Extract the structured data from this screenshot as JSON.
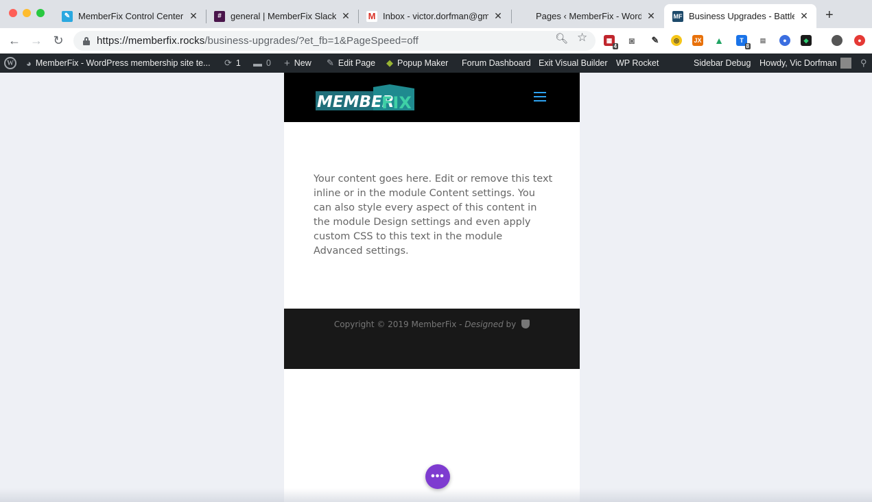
{
  "browser": {
    "tabs": [
      {
        "title": "MemberFix Control Center",
        "favicon_color": "#2aa8e0",
        "icon": "memberfix-tab-icon"
      },
      {
        "title": "general | MemberFix Slack",
        "favicon_color": "#4a154b",
        "icon": "slack-icon"
      },
      {
        "title": "Inbox - victor.dorfman@gm",
        "favicon_color": "#ffffff",
        "icon": "gmail-icon"
      },
      {
        "title": "Pages ‹ MemberFix - Word",
        "favicon_color": "#dee1e6",
        "icon": "wordpress-tab-icon"
      },
      {
        "title": "Business Upgrades - Battle",
        "favicon_color": "#1d4a6b",
        "icon": "memberfix-mf-icon"
      }
    ],
    "new_tab_label": "+",
    "url_host": "https://memberfix.rocks",
    "url_path": "/business-upgrades/?et_fb=1&PageSpeed=off",
    "extension_badges": {
      "ext1": "4",
      "ext2": "8"
    }
  },
  "admin_bar": {
    "wp_logo": "W",
    "site_name": "MemberFix - WordPress membership site te...",
    "updates_count": "1",
    "comments_count": "0",
    "new_label": "New",
    "edit_page": "Edit Page",
    "popup_maker": "Popup Maker",
    "forum_dashboard": "Forum Dashboard",
    "exit_builder": "Exit Visual Builder",
    "wp_rocket": "WP Rocket",
    "sidebar_debug": "Sidebar Debug",
    "howdy": "Howdy, Vic Dorfman"
  },
  "site": {
    "logo_text_member": "MEMBER",
    "logo_text_fix": "FIX",
    "content": "Your content goes here. Edit or remove this text inline or in the module Content settings. You can also style every aspect of this content in the module Design settings and even apply custom CSS to this text in the module Advanced settings.",
    "footer_copyright": "Copyright © 2019 MemberFix - ",
    "footer_designed": "Designed",
    "footer_by": " by ",
    "fab_label": "•••"
  },
  "colors": {
    "accent": "#2ea3f2",
    "fab": "#7e3bd0",
    "admin_bar": "#23282d"
  }
}
